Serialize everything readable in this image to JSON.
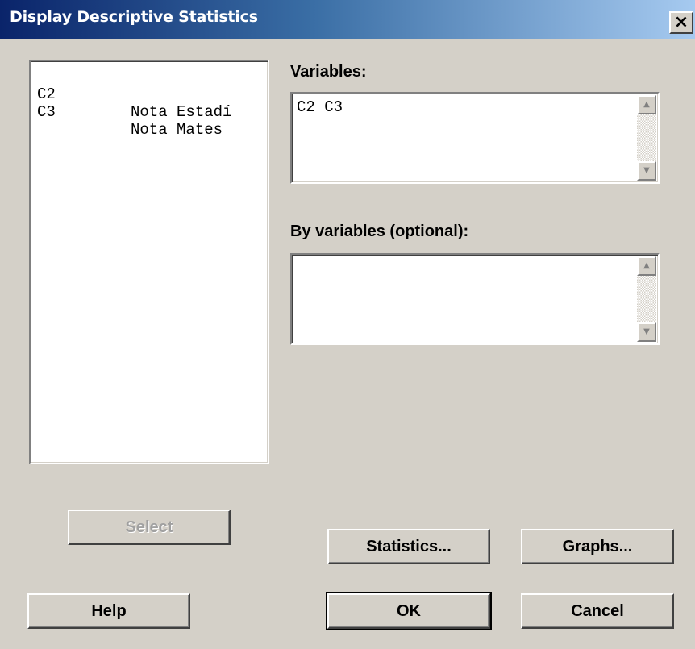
{
  "window": {
    "title": "Display Descriptive Statistics",
    "close_label": "×"
  },
  "columns": [
    {
      "id": "C2",
      "name": "Nota Estadí"
    },
    {
      "id": "C3",
      "name": "Nota Mates"
    }
  ],
  "variables": {
    "label": "Variables:",
    "value": "C2 C3"
  },
  "by_variables": {
    "label": "By variables (optional):",
    "value": ""
  },
  "scroll": {
    "up_glyph": "▲",
    "down_glyph": "▼"
  },
  "buttons": {
    "select": "Select",
    "statistics": "Statistics...",
    "graphs": "Graphs...",
    "help": "Help",
    "ok": "OK",
    "cancel": "Cancel"
  },
  "colors": {
    "titlebar_start": "#0a246a",
    "titlebar_end": "#a6caf0",
    "dialog_bg": "#d4d0c8"
  }
}
